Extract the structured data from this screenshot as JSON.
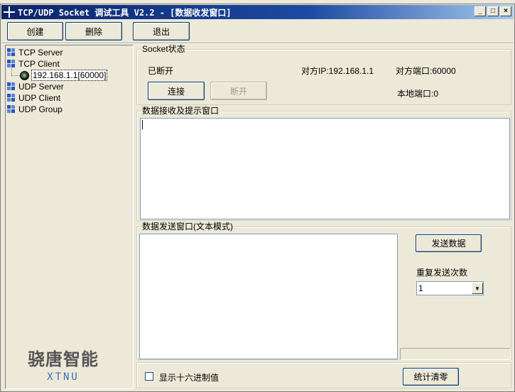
{
  "window": {
    "title": "TCP/UDP Socket 调试工具 V2.2 - [数据收发窗口]",
    "controls": {
      "minimize": "_",
      "maximize": "□",
      "close": "×"
    }
  },
  "toolbar": {
    "create_label": "创建",
    "delete_label": "删除",
    "exit_label": "退出"
  },
  "tree": {
    "items": [
      {
        "label": "TCP Server"
      },
      {
        "label": "TCP Client"
      },
      {
        "label": "192.168.1.1[60000]"
      },
      {
        "label": "UDP Server"
      },
      {
        "label": "UDP Client"
      },
      {
        "label": "UDP Group"
      }
    ]
  },
  "logo": {
    "text": "骁唐智能",
    "sub": "XTNU"
  },
  "socket": {
    "group_title": "Socket状态",
    "status": "已断开",
    "remote_ip": "对方IP:192.168.1.1",
    "remote_port": "对方端口:60000",
    "local_port": "本地端口:0",
    "connect_label": "连接",
    "disconnect_label": "断开"
  },
  "receive": {
    "group_title": "数据接收及提示窗口",
    "content": ""
  },
  "send": {
    "group_title": "数据发送窗口(文本模式)",
    "content": "",
    "send_label": "发送数据",
    "repeat_label": "重复发送次数",
    "repeat_value": "1"
  },
  "footer": {
    "hex_label": "显示十六进制值",
    "clear_stats_label": "统计清零"
  },
  "colors": {
    "titlebar": "#0a246a",
    "face": "#ece9d8"
  }
}
